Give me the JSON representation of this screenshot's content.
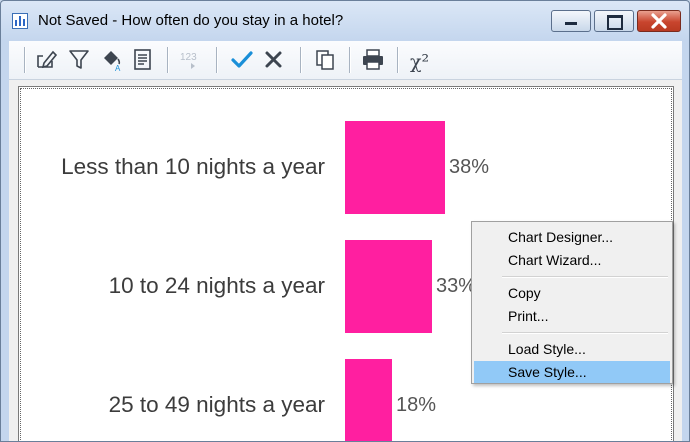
{
  "window": {
    "title": "Not Saved - How often do you stay in a hotel?",
    "app_icon": "bar-chart-icon",
    "controls": [
      "minimize-icon",
      "maximize-icon",
      "close-icon"
    ]
  },
  "toolbar": {
    "buttons": [
      {
        "name": "edit-icon"
      },
      {
        "name": "filter-icon"
      },
      {
        "name": "fill-color-icon"
      },
      {
        "name": "document-icon"
      },
      {
        "name": "number-format-icon",
        "label": "123"
      },
      {
        "name": "check-icon"
      },
      {
        "name": "cross-icon"
      },
      {
        "name": "copy-icon"
      },
      {
        "name": "print-icon"
      },
      {
        "name": "chi-square-icon",
        "label": "χ²"
      }
    ],
    "colors": {
      "check": "#1a8fd8",
      "disabled": "#b7bfca",
      "icon": "#3d4550"
    }
  },
  "chart_data": {
    "type": "bar",
    "orientation": "horizontal",
    "categories": [
      "Less than 10 nights a year",
      "10 to 24 nights a year",
      "25 to 49 nights a year"
    ],
    "values": [
      38,
      33,
      18
    ],
    "value_labels": [
      "38%",
      "33%",
      "18%"
    ],
    "unit": "%",
    "bar_color": "#ff1fa0"
  },
  "context_menu": {
    "groups": [
      [
        {
          "label": "Chart Designer..."
        },
        {
          "label": "Chart Wizard..."
        }
      ],
      [
        {
          "label": "Copy"
        },
        {
          "label": "Print..."
        }
      ],
      [
        {
          "label": "Load Style..."
        },
        {
          "label": "Save Style...",
          "highlighted": true
        }
      ]
    ],
    "highlight_color": "#91c9f7"
  }
}
